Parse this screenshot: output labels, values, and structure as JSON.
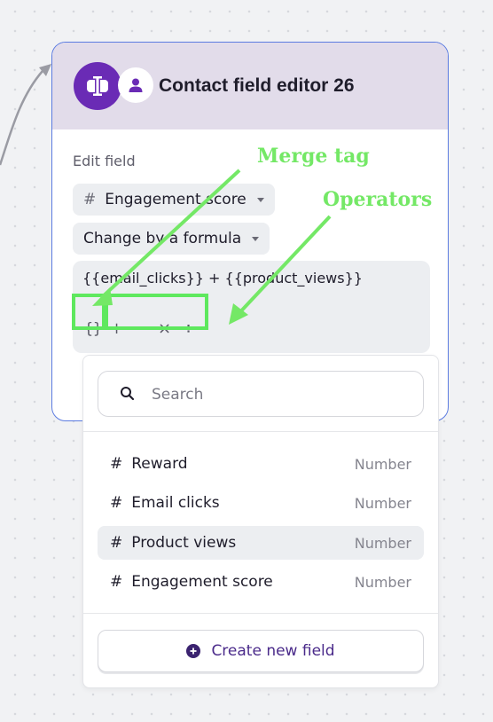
{
  "node": {
    "title": "Contact field editor 26",
    "app_icon": "formula-icon",
    "person_icon": "person-icon",
    "edit_label": "Edit field",
    "field_select": {
      "hash": "#",
      "value": "Engagement score"
    },
    "mode_select": {
      "value": "Change by a formula"
    },
    "formula": "{{email_clicks}} + {{product_views}}",
    "toolbar": {
      "merge_tag": "{}",
      "plus": "+",
      "minus": "−",
      "times": "×",
      "divide": "÷"
    }
  },
  "dropdown": {
    "search_placeholder": "Search",
    "items": [
      {
        "hash": "#",
        "name": "Reward",
        "type": "Number",
        "active": false
      },
      {
        "hash": "#",
        "name": "Email clicks",
        "type": "Number",
        "active": false
      },
      {
        "hash": "#",
        "name": "Product views",
        "type": "Number",
        "active": true
      },
      {
        "hash": "#",
        "name": "Engagement score",
        "type": "Number",
        "active": false
      }
    ],
    "create_label": "Create new field"
  },
  "annotations": {
    "merge_tag": "Merge tag",
    "operators": "Operators",
    "color": "#5ee85e"
  },
  "colors": {
    "accent": "#6a2bb5",
    "node_border": "#5b7be0",
    "header_bg": "#e2dcea"
  }
}
